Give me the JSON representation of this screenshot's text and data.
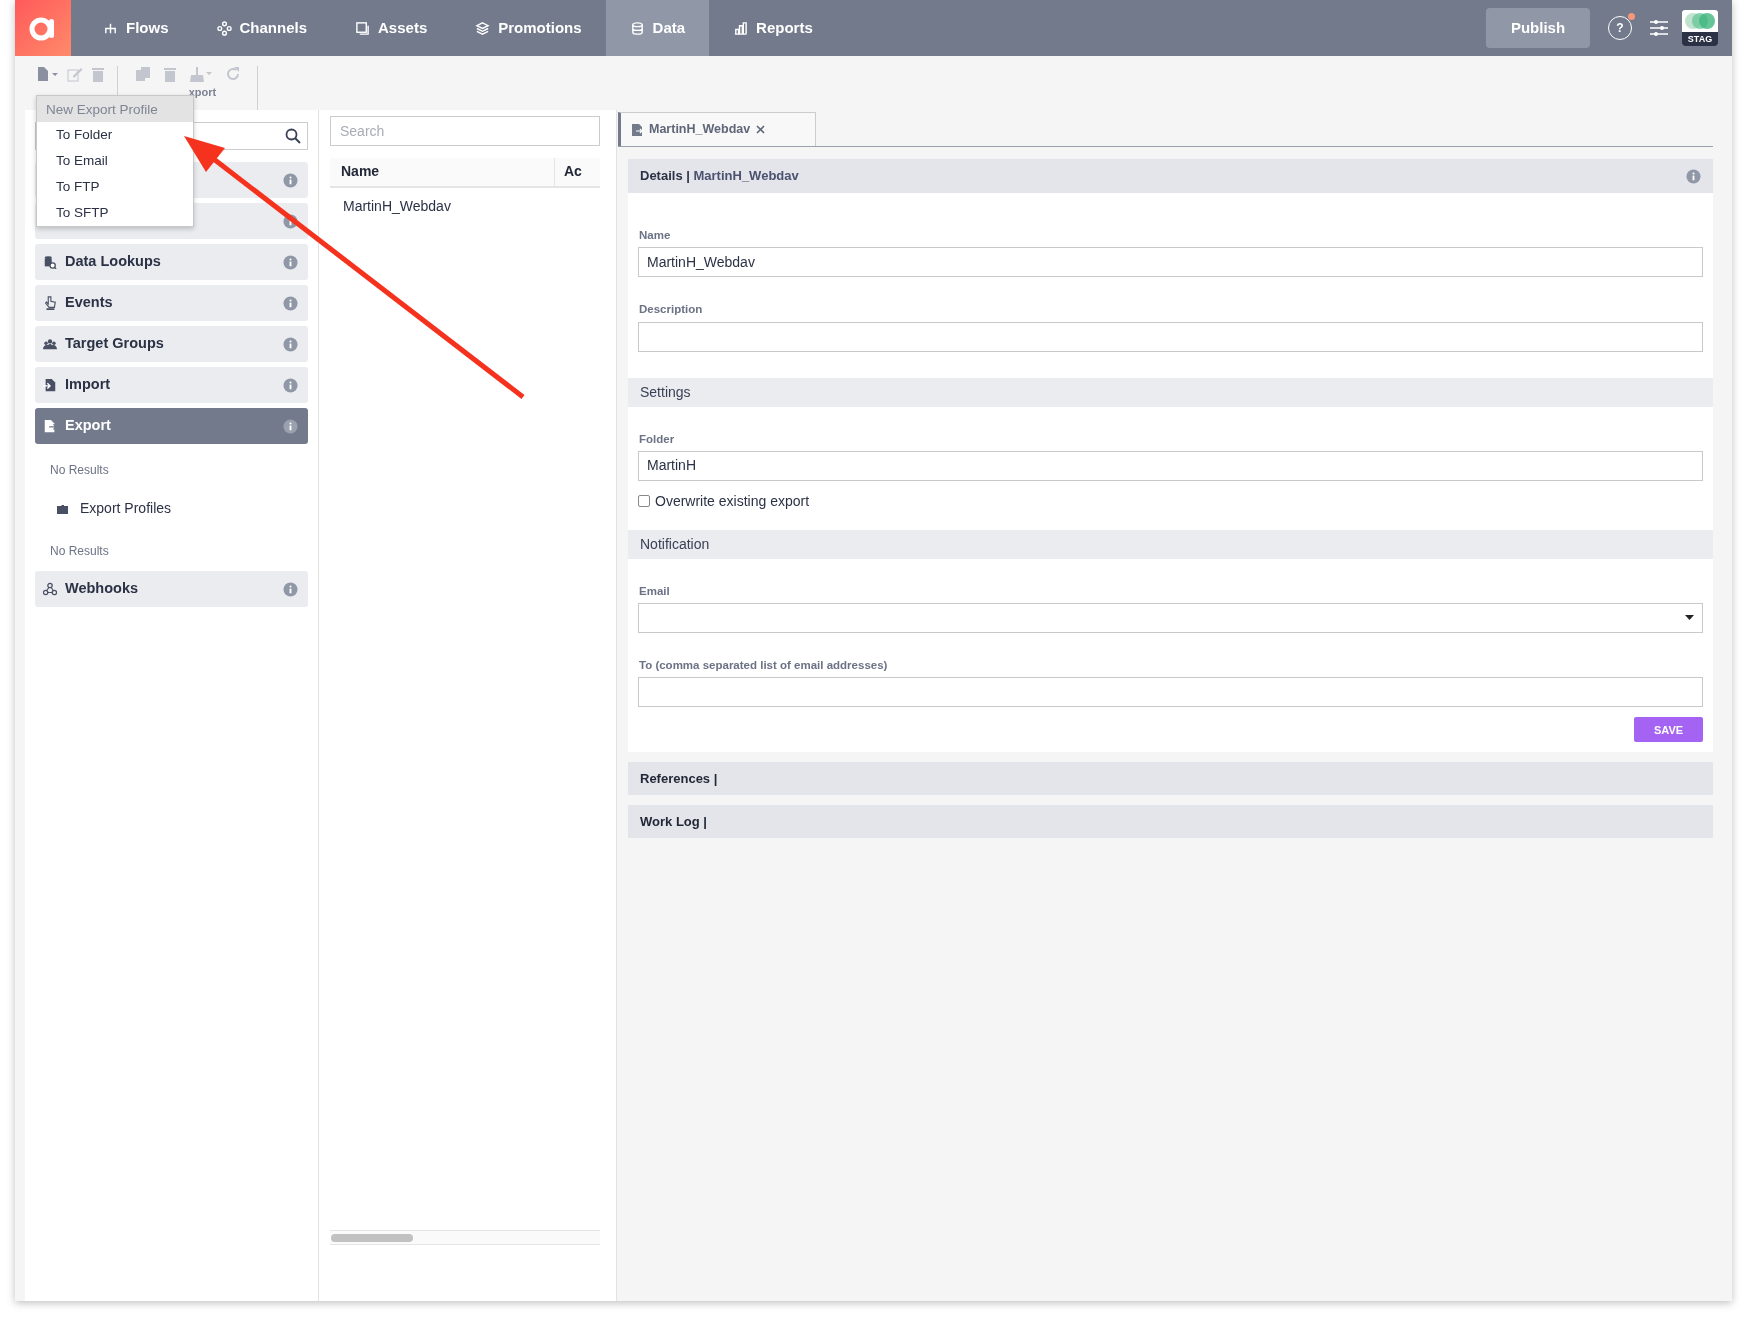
{
  "nav": {
    "items": [
      {
        "label": "Flows",
        "selected": false
      },
      {
        "label": "Channels",
        "selected": false
      },
      {
        "label": "Assets",
        "selected": false
      },
      {
        "label": "Promotions",
        "selected": false
      },
      {
        "label": "Data",
        "selected": true
      },
      {
        "label": "Reports",
        "selected": false
      }
    ],
    "publish": "Publish",
    "help": "?",
    "environment": "STAG"
  },
  "toolbar": {
    "group_label": "xport"
  },
  "new_menu": {
    "header": "New Export Profile",
    "items": [
      "To Folder",
      "To Email",
      "To FTP",
      "To SFTP"
    ]
  },
  "sidebar": {
    "items": [
      {
        "kind": "section",
        "selected": false
      },
      {
        "kind": "section",
        "selected": false
      },
      {
        "kind": "section",
        "label": "Data Lookups",
        "selected": false
      },
      {
        "kind": "section",
        "label": "Events",
        "selected": false
      },
      {
        "kind": "section",
        "label": "Target Groups",
        "selected": false
      },
      {
        "kind": "section",
        "label": "Import",
        "selected": false
      },
      {
        "kind": "section",
        "label": "Export",
        "selected": true
      },
      {
        "kind": "empty",
        "label": "No Results"
      },
      {
        "kind": "folder",
        "label": "Export Profiles"
      },
      {
        "kind": "empty",
        "label": "No Results"
      },
      {
        "kind": "section",
        "label": "Webhooks",
        "selected": false
      }
    ]
  },
  "list": {
    "placeholder": "Search",
    "columns": [
      "Name",
      "Ac"
    ],
    "rows": [
      "MartinH_Webdav"
    ]
  },
  "editor": {
    "tab": {
      "title": "MartinH_Webdav",
      "selected": true
    },
    "heading": "Details |",
    "subject": "MartinH_Webdav",
    "fields": [
      {
        "kind": "text",
        "label": "Name",
        "value": "MartinH_Webdav"
      },
      {
        "kind": "text",
        "label": "Description"
      }
    ],
    "sections": [
      {
        "title": "Settings",
        "fields": [
          {
            "kind": "text",
            "label": "Folder",
            "value": "MartinH"
          },
          {
            "kind": "checkbox",
            "label": "Overwrite existing export",
            "checked": false
          }
        ]
      },
      {
        "title": "Notification",
        "fields": [
          {
            "kind": "select",
            "label": "Email"
          },
          {
            "kind": "text",
            "label": "To (comma separated list of email addresses)"
          }
        ]
      }
    ],
    "save": "SAVE",
    "collapsed": [
      "References |",
      "Work Log |"
    ]
  }
}
